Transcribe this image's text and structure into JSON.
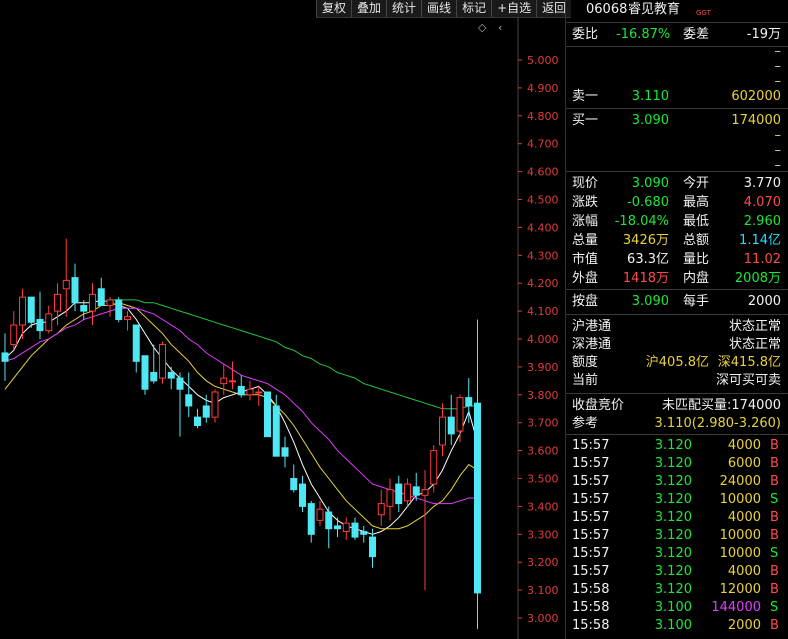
{
  "toolbar": {
    "items": [
      "复权",
      "叠加",
      "统计",
      "画线",
      "标记",
      "+自选",
      "返回"
    ]
  },
  "stock": {
    "code": "06068",
    "name": "睿见教育",
    "tag": "GGT"
  },
  "weibi": {
    "label": "委比",
    "value": "-16.87%",
    "diff_label": "委差",
    "diff_value": "-19万"
  },
  "sell_levels": [
    {
      "label": "",
      "price": "",
      "volume": "–"
    },
    {
      "label": "",
      "price": "",
      "volume": "–"
    },
    {
      "label": "",
      "price": "",
      "volume": "–"
    },
    {
      "label": "卖一",
      "price": "3.110",
      "volume": "602000"
    }
  ],
  "buy_levels": [
    {
      "label": "买一",
      "price": "3.090",
      "volume": "174000"
    },
    {
      "label": "",
      "price": "",
      "volume": "–"
    },
    {
      "label": "",
      "price": "",
      "volume": "–"
    },
    {
      "label": "",
      "price": "",
      "volume": "–"
    }
  ],
  "quote": [
    {
      "l1": "现价",
      "v1": "3.090",
      "c1": "green",
      "l2": "今开",
      "v2": "3.770",
      "c2": "white"
    },
    {
      "l1": "涨跌",
      "v1": "-0.680",
      "c1": "green",
      "l2": "最高",
      "v2": "4.070",
      "c2": "red"
    },
    {
      "l1": "涨幅",
      "v1": "-18.04%",
      "c1": "green",
      "l2": "最低",
      "v2": "2.960",
      "c2": "green"
    },
    {
      "l1": "总量",
      "v1": "3426万",
      "c1": "yellow",
      "l2": "总额",
      "v2": "1.14亿",
      "c2": "cyan"
    },
    {
      "l1": "市值",
      "v1": "63.3亿",
      "c1": "white",
      "l2": "量比",
      "v2": "11.02",
      "c2": "red"
    },
    {
      "l1": "外盘",
      "v1": "1418万",
      "c1": "red",
      "l2": "内盘",
      "v2": "2008万",
      "c2": "green"
    }
  ],
  "lot": {
    "l1": "按盘",
    "v1": "3.090",
    "l2": "每手",
    "v2": "2000"
  },
  "connect": [
    {
      "label": "沪港通",
      "value": "状态正常"
    },
    {
      "label": "深港通",
      "value": "状态正常"
    }
  ],
  "quota": {
    "label": "额度",
    "sh": "沪405.8亿",
    "sz": "深415.8亿"
  },
  "current": {
    "label": "当前",
    "value": "深可买可卖"
  },
  "auction": {
    "label": "收盘竞价",
    "unmatched": "未匹配买量:174000"
  },
  "reference": {
    "label": "参考",
    "value": "3.110(2.980-3.260)"
  },
  "trades": [
    {
      "time": "15:57",
      "price": "3.120",
      "vol": "4000",
      "side": "B",
      "vcol": "yellow"
    },
    {
      "time": "15:57",
      "price": "3.120",
      "vol": "6000",
      "side": "B",
      "vcol": "yellow"
    },
    {
      "time": "15:57",
      "price": "3.120",
      "vol": "24000",
      "side": "B",
      "vcol": "yellow"
    },
    {
      "time": "15:57",
      "price": "3.120",
      "vol": "10000",
      "side": "S",
      "vcol": "yellow"
    },
    {
      "time": "15:57",
      "price": "3.120",
      "vol": "4000",
      "side": "B",
      "vcol": "yellow"
    },
    {
      "time": "15:57",
      "price": "3.120",
      "vol": "10000",
      "side": "B",
      "vcol": "yellow"
    },
    {
      "time": "15:57",
      "price": "3.120",
      "vol": "10000",
      "side": "S",
      "vcol": "yellow"
    },
    {
      "time": "15:57",
      "price": "3.120",
      "vol": "4000",
      "side": "B",
      "vcol": "yellow"
    },
    {
      "time": "15:58",
      "price": "3.120",
      "vol": "12000",
      "side": "B",
      "vcol": "yellow"
    },
    {
      "time": "15:58",
      "price": "3.100",
      "vol": "144000",
      "side": "S",
      "vcol": "magenta"
    },
    {
      "time": "15:58",
      "price": "3.100",
      "vol": "2000",
      "side": "B",
      "vcol": "yellow"
    }
  ],
  "chart_data": {
    "type": "candlestick",
    "ylim": [
      2.95,
      5.05
    ],
    "y_ticks": [
      "5.000",
      "4.900",
      "4.800",
      "4.700",
      "4.600",
      "4.500",
      "4.400",
      "4.300",
      "4.200",
      "4.100",
      "4.000",
      "3.900",
      "3.800",
      "3.700",
      "3.600",
      "3.500",
      "3.400",
      "3.300",
      "3.200",
      "3.100",
      "3.000"
    ],
    "candles": [
      [
        3.95,
        4.02,
        3.85,
        3.92
      ],
      [
        3.98,
        4.1,
        3.96,
        4.05
      ],
      [
        4.05,
        4.18,
        4.0,
        4.15
      ],
      [
        4.15,
        4.1,
        4.04,
        4.06
      ],
      [
        4.07,
        4.17,
        4.0,
        4.03
      ],
      [
        4.03,
        4.12,
        4.02,
        4.09
      ],
      [
        4.1,
        4.2,
        4.05,
        4.16
      ],
      [
        4.18,
        4.36,
        4.08,
        4.21
      ],
      [
        4.22,
        4.27,
        4.1,
        4.13
      ],
      [
        4.12,
        4.14,
        4.07,
        4.1
      ],
      [
        4.1,
        4.2,
        4.05,
        4.16
      ],
      [
        4.18,
        4.22,
        4.12,
        4.12
      ],
      [
        4.12,
        4.15,
        4.08,
        4.14
      ],
      [
        4.14,
        4.15,
        4.06,
        4.07
      ],
      [
        4.07,
        4.1,
        4.03,
        4.08
      ],
      [
        4.05,
        4.05,
        3.88,
        3.92
      ],
      [
        3.94,
        3.94,
        3.8,
        3.82
      ],
      [
        3.88,
        3.98,
        3.84,
        3.85
      ],
      [
        3.86,
        3.99,
        3.84,
        3.98
      ],
      [
        3.88,
        3.9,
        3.82,
        3.86
      ],
      [
        3.86,
        3.88,
        3.65,
        3.82
      ],
      [
        3.8,
        3.88,
        3.72,
        3.76
      ],
      [
        3.72,
        3.75,
        3.68,
        3.69
      ],
      [
        3.76,
        3.8,
        3.7,
        3.72
      ],
      [
        3.72,
        3.82,
        3.7,
        3.81
      ],
      [
        3.84,
        3.91,
        3.8,
        3.86
      ],
      [
        3.85,
        3.92,
        3.82,
        3.85
      ],
      [
        3.83,
        3.87,
        3.79,
        3.8
      ],
      [
        3.8,
        3.85,
        3.78,
        3.82
      ],
      [
        3.81,
        3.83,
        3.76,
        3.81
      ],
      [
        3.81,
        3.8,
        3.66,
        3.65
      ],
      [
        3.76,
        3.8,
        3.58,
        3.58
      ],
      [
        3.61,
        3.65,
        3.54,
        3.58
      ],
      [
        3.5,
        3.55,
        3.45,
        3.46
      ],
      [
        3.48,
        3.51,
        3.38,
        3.4
      ],
      [
        3.41,
        3.42,
        3.27,
        3.3
      ],
      [
        3.35,
        3.42,
        3.33,
        3.39
      ],
      [
        3.38,
        3.4,
        3.25,
        3.32
      ],
      [
        3.33,
        3.36,
        3.29,
        3.32
      ],
      [
        3.31,
        3.36,
        3.28,
        3.34
      ],
      [
        3.34,
        3.36,
        3.28,
        3.29
      ],
      [
        3.31,
        3.33,
        3.27,
        3.3
      ],
      [
        3.29,
        3.32,
        3.18,
        3.22
      ],
      [
        3.37,
        3.46,
        3.33,
        3.41
      ],
      [
        3.4,
        3.5,
        3.35,
        3.46
      ],
      [
        3.48,
        3.51,
        3.38,
        3.41
      ],
      [
        3.42,
        3.5,
        3.4,
        3.48
      ],
      [
        3.47,
        3.52,
        3.42,
        3.44
      ],
      [
        3.44,
        3.53,
        3.1,
        3.46
      ],
      [
        3.48,
        3.62,
        3.45,
        3.6
      ],
      [
        3.62,
        3.77,
        3.58,
        3.72
      ],
      [
        3.72,
        3.8,
        3.62,
        3.66
      ],
      [
        3.67,
        3.8,
        3.63,
        3.79
      ],
      [
        3.79,
        3.86,
        3.7,
        3.76
      ],
      [
        3.77,
        4.07,
        2.96,
        3.09
      ]
    ],
    "ma_lines": [
      {
        "color": "#ffffff",
        "values": [
          3.93,
          3.96,
          4.02,
          4.05,
          4.06,
          4.06,
          4.08,
          4.1,
          4.13,
          4.13,
          4.13,
          4.14,
          4.13,
          4.12,
          4.11,
          4.07,
          4.02,
          3.97,
          3.93,
          3.89,
          3.86,
          3.83,
          3.8,
          3.78,
          3.77,
          3.79,
          3.8,
          3.81,
          3.82,
          3.83,
          3.8,
          3.76,
          3.7,
          3.63,
          3.55,
          3.48,
          3.43,
          3.38,
          3.35,
          3.33,
          3.32,
          3.31,
          3.3,
          3.31,
          3.33,
          3.36,
          3.4,
          3.44,
          3.45,
          3.48,
          3.53,
          3.6,
          3.66,
          3.74,
          3.63
        ]
      },
      {
        "color": "#e8d13c",
        "values": [
          3.82,
          3.86,
          3.9,
          3.94,
          3.97,
          4.0,
          4.02,
          4.05,
          4.07,
          4.09,
          4.1,
          4.12,
          4.12,
          4.13,
          4.12,
          4.11,
          4.08,
          4.05,
          4.02,
          3.98,
          3.95,
          3.92,
          3.88,
          3.85,
          3.83,
          3.82,
          3.81,
          3.8,
          3.8,
          3.8,
          3.79,
          3.76,
          3.73,
          3.69,
          3.64,
          3.59,
          3.54,
          3.5,
          3.46,
          3.42,
          3.39,
          3.36,
          3.33,
          3.32,
          3.32,
          3.32,
          3.33,
          3.35,
          3.37,
          3.4,
          3.42,
          3.46,
          3.51,
          3.55,
          3.53
        ]
      },
      {
        "color": "#e03cff",
        "values": [
          3.92,
          3.93,
          3.95,
          3.97,
          3.99,
          4.0,
          4.02,
          4.04,
          4.05,
          4.07,
          4.08,
          4.09,
          4.1,
          4.11,
          4.11,
          4.11,
          4.1,
          4.09,
          4.07,
          4.05,
          4.03,
          4.0,
          3.98,
          3.95,
          3.93,
          3.91,
          3.89,
          3.87,
          3.86,
          3.85,
          3.84,
          3.82,
          3.8,
          3.77,
          3.74,
          3.7,
          3.67,
          3.64,
          3.6,
          3.57,
          3.54,
          3.51,
          3.48,
          3.47,
          3.46,
          3.45,
          3.44,
          3.43,
          3.42,
          3.41,
          3.41,
          3.41,
          3.42,
          3.43,
          3.43
        ]
      },
      {
        "color": "#22c43a",
        "values": [
          null,
          null,
          null,
          null,
          null,
          null,
          null,
          null,
          null,
          null,
          null,
          4.13,
          4.14,
          4.14,
          4.14,
          4.14,
          4.13,
          4.13,
          4.12,
          4.11,
          4.1,
          4.09,
          4.08,
          4.07,
          4.06,
          4.05,
          4.04,
          4.03,
          4.02,
          4.01,
          4.0,
          3.99,
          3.97,
          3.96,
          3.94,
          3.93,
          3.91,
          3.9,
          3.88,
          3.87,
          3.86,
          3.84,
          3.83,
          3.82,
          3.81,
          3.8,
          3.79,
          3.78,
          3.77,
          3.76,
          3.75,
          3.75,
          3.75,
          3.76,
          3.76
        ]
      }
    ]
  }
}
